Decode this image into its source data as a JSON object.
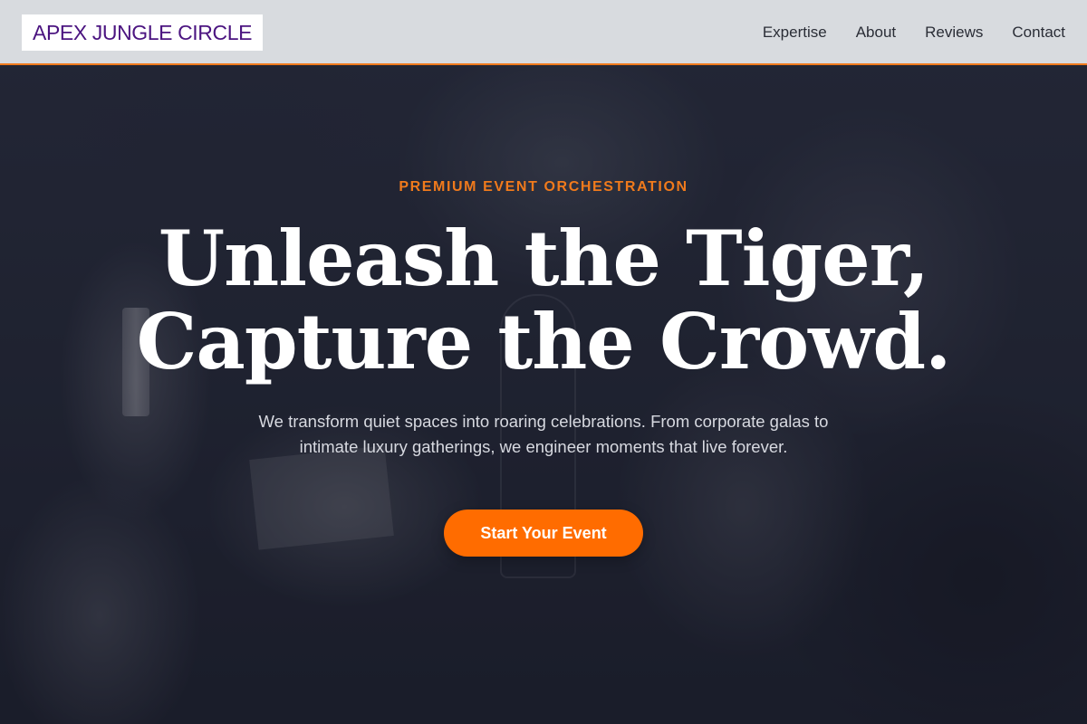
{
  "header": {
    "logo_text": "APEX JUNGLE CIRCLE",
    "nav": [
      {
        "label": "Expertise"
      },
      {
        "label": "About"
      },
      {
        "label": "Reviews"
      },
      {
        "label": "Contact"
      }
    ]
  },
  "hero": {
    "eyebrow": "PREMIUM EVENT ORCHESTRATION",
    "headline_line1": "Unleash the Tiger,",
    "headline_line2": "Capture the Crowd.",
    "subtitle": "We transform quiet spaces into roaring celebrations. From corporate galas to intimate luxury gatherings, we engineer moments that live forever.",
    "cta_label": "Start Your Event",
    "background_image": "dim event photo of guests raising glasses at a candlelit dinner"
  },
  "colors": {
    "accent": "#ff6c00",
    "logo_text": "#4b1480",
    "header_border": "#f07a1c",
    "headline": "#ffffff"
  }
}
